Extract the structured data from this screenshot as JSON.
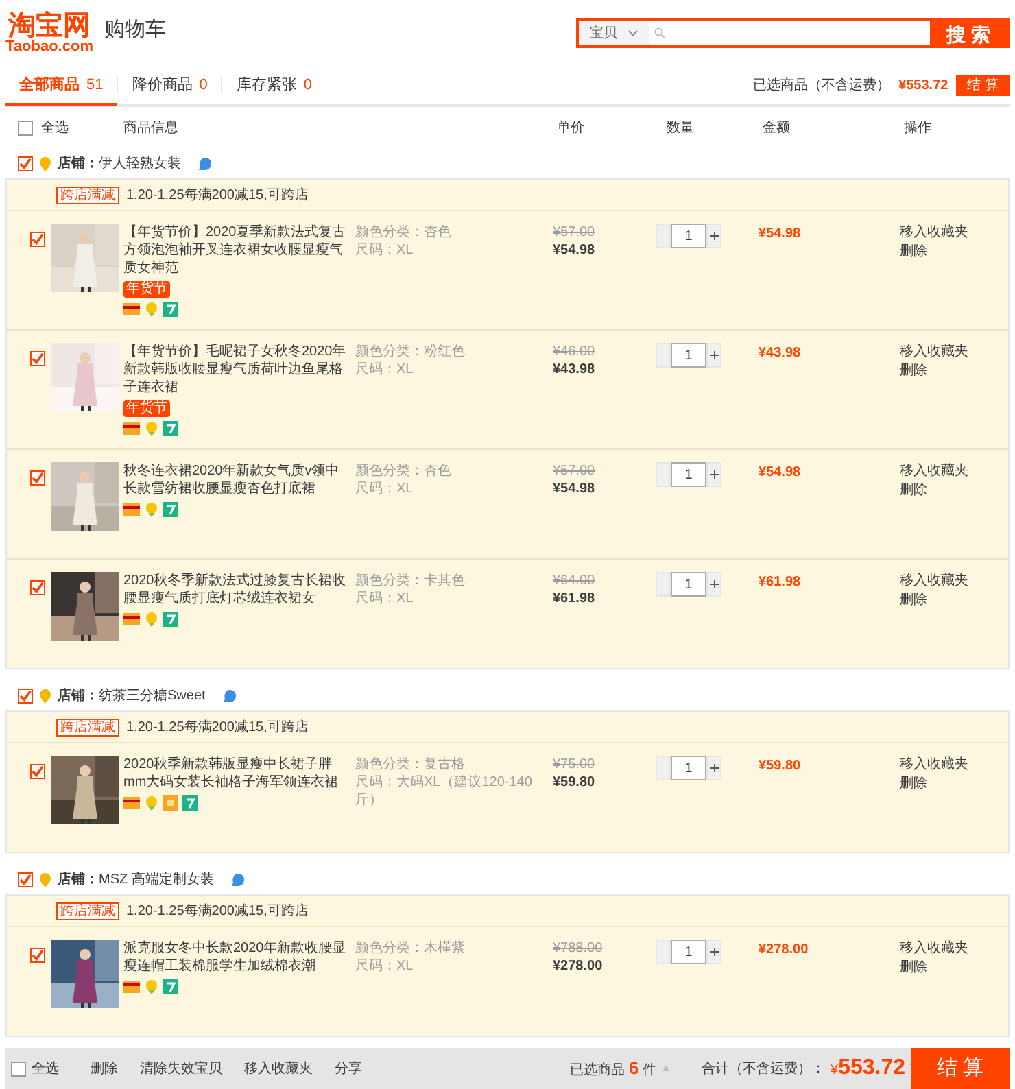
{
  "header": {
    "logo_cn": "淘宝网",
    "logo_en": "Taobao.com",
    "page_title": "购物车",
    "search": {
      "category": "宝贝",
      "button": "搜 索"
    }
  },
  "tabs": [
    {
      "label": "全部商品",
      "count": "51",
      "selected": true
    },
    {
      "label": "降价商品",
      "count": "0",
      "selected": false
    },
    {
      "label": "库存紧张",
      "count": "0",
      "selected": false
    }
  ],
  "summary_top": {
    "label": "已选商品（不含运费）",
    "total": "¥553.72",
    "button": "结 算"
  },
  "select_all": {
    "label": "全选",
    "checked": false
  },
  "columns": [
    "商品信息",
    "单价",
    "数量",
    "金额",
    "操作"
  ],
  "shops": [
    {
      "label": "店铺：",
      "name": "伊人轻熟女装",
      "checked": true,
      "promo": {
        "tag": "跨店满减",
        "text": "1.20-1.25每满200减15,可跨店"
      },
      "items": [
        {
          "checked": true,
          "title": "【年货节价】2020夏季新款法式复古方领泡泡袖开叉连衣裙女收腰显瘦气质女神范",
          "tag": "年货节",
          "services": [
            {
              "kind": "card"
            },
            {
              "kind": "medal"
            },
            {
              "kind": "seven"
            }
          ],
          "specs": [
            "颜色分类：杏色",
            "尺码：XL"
          ],
          "original_price": "¥57.00",
          "price": "¥54.98",
          "quantity": "1",
          "amount": "¥54.98",
          "actions": [
            "移入收藏夹",
            "删除"
          ]
        },
        {
          "checked": true,
          "title": "【年货节价】毛呢裙子女秋冬2020年新款韩版收腰显瘦气质荷叶边鱼尾格子连衣裙",
          "tag": "年货节",
          "services": [
            {
              "kind": "card"
            },
            {
              "kind": "medal"
            },
            {
              "kind": "seven"
            }
          ],
          "specs": [
            "颜色分类：粉红色",
            "尺码：XL"
          ],
          "original_price": "¥46.00",
          "price": "¥43.98",
          "quantity": "1",
          "amount": "¥43.98",
          "actions": [
            "移入收藏夹",
            "删除"
          ]
        },
        {
          "checked": true,
          "title": "秋冬连衣裙2020年新款女气质v领中长款雪纺裙收腰显瘦杏色打底裙",
          "services": [
            {
              "kind": "card"
            },
            {
              "kind": "medal"
            },
            {
              "kind": "seven"
            }
          ],
          "specs": [
            "颜色分类：杏色",
            "尺码：XL"
          ],
          "original_price": "¥57.00",
          "price": "¥54.98",
          "quantity": "1",
          "amount": "¥54.98",
          "actions": [
            "移入收藏夹",
            "删除"
          ]
        },
        {
          "checked": true,
          "title": "2020秋冬季新款法式过膝复古长裙收腰显瘦气质打底灯芯绒连衣裙女",
          "services": [
            {
              "kind": "card"
            },
            {
              "kind": "medal"
            },
            {
              "kind": "seven"
            }
          ],
          "specs": [
            "颜色分类：卡其色",
            "尺码：XL"
          ],
          "original_price": "¥64.00",
          "price": "¥61.98",
          "quantity": "1",
          "amount": "¥61.98",
          "actions": [
            "移入收藏夹",
            "删除"
          ]
        }
      ]
    },
    {
      "label": "店铺：",
      "name": "纺茶三分糖Sweet",
      "checked": true,
      "promo": {
        "tag": "跨店满减",
        "text": "1.20-1.25每满200减15,可跨店"
      },
      "items": [
        {
          "checked": true,
          "title": "2020秋季新款韩版显瘦中长裙子胖mm大码女装长袖格子海军领连衣裙",
          "services": [
            {
              "kind": "card"
            },
            {
              "kind": "medal"
            },
            {
              "kind": "badge"
            },
            {
              "kind": "seven"
            }
          ],
          "specs": [
            "颜色分类：复古格",
            "尺码：大码XL（建议120-140斤）"
          ],
          "original_price": "¥75.00",
          "price": "¥59.80",
          "quantity": "1",
          "amount": "¥59.80",
          "actions": [
            "移入收藏夹",
            "删除"
          ]
        }
      ]
    },
    {
      "label": "店铺：",
      "name": "MSZ 高端定制女装",
      "checked": true,
      "promo": {
        "tag": "跨店满减",
        "text": "1.20-1.25每满200减15,可跨店"
      },
      "items": [
        {
          "checked": true,
          "title": "派克服女冬中长款2020年新款收腰显瘦连帽工装棉服学生加绒棉衣潮",
          "services": [
            {
              "kind": "card"
            },
            {
              "kind": "medal"
            },
            {
              "kind": "seven"
            }
          ],
          "specs": [
            "颜色分类：木槿紫",
            "尺码：XL"
          ],
          "original_price": "¥788.00",
          "price": "¥278.00",
          "quantity": "1",
          "amount": "¥278.00",
          "actions": [
            "移入收藏夹",
            "删除"
          ]
        }
      ]
    }
  ],
  "footer": {
    "select_all": {
      "label": "全选",
      "checked": false
    },
    "actions": [
      "删除",
      "清除失效宝贝",
      "移入收藏夹",
      "分享"
    ],
    "selected_label": "已选商品",
    "selected_count": "6",
    "unit": "件",
    "total_label": "合计（不含运费）：",
    "currency": "¥",
    "total": "553.72",
    "button": "结 算"
  }
}
